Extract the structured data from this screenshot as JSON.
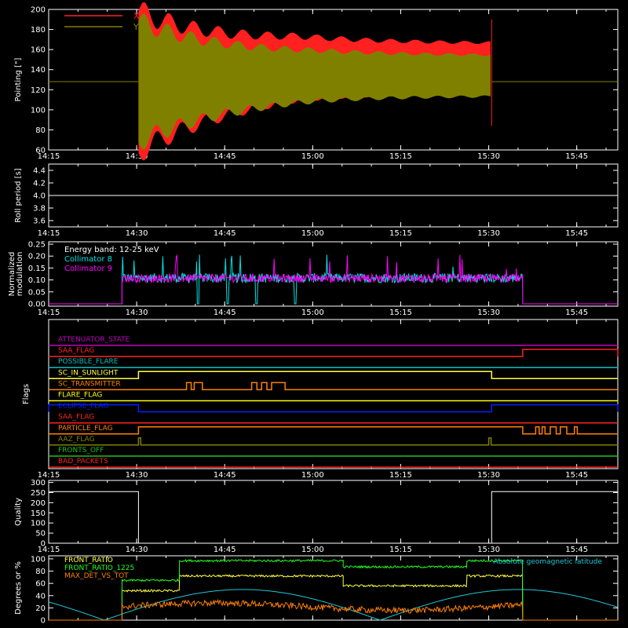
{
  "colors": {
    "background": "#000000",
    "axes": "#ffffff",
    "x_pointing": "#ff2020",
    "y_pointing": "#808000",
    "collimator8": "#00e0e0",
    "collimator9": "#ff00ff",
    "front_ratio": "#ffff40",
    "front_ratio_1225": "#20ff20",
    "max_det": "#ff8000",
    "geomag": "#20c8d8"
  },
  "chart_data": [
    {
      "id": "pointing",
      "type": "area",
      "ylabel": "Pointing [\"]",
      "ylim": [
        60,
        200
      ],
      "yticks": [
        60,
        80,
        100,
        120,
        140,
        160,
        180,
        200
      ],
      "xlim_min": [
        855,
        952
      ],
      "xticks": [
        {
          "m": 855,
          "label": "14:15"
        },
        {
          "m": 870,
          "label": "14:30"
        },
        {
          "m": 885,
          "label": "14:45"
        },
        {
          "m": 900,
          "label": "15:00"
        },
        {
          "m": 915,
          "label": "15:15"
        },
        {
          "m": 930,
          "label": "15:30"
        },
        {
          "m": 945,
          "label": "15:45"
        }
      ],
      "baseline": 128,
      "active_range": [
        870.3,
        930.5
      ],
      "series": [
        {
          "name": "X",
          "color_key": "x_pointing"
        },
        {
          "name": "Y",
          "color_key": "y_pointing"
        }
      ]
    },
    {
      "id": "roll",
      "type": "line",
      "ylabel": "Roll period [s]",
      "ylim": [
        3.5,
        4.5
      ],
      "yticks": [
        3.6,
        3.8,
        4.0,
        4.2,
        4.4
      ],
      "ytick_labels": [
        "3.6",
        "3.8",
        "4.0",
        "4.2",
        "4.4"
      ],
      "xticks_labels": [
        "14:15",
        "14:30",
        "14:45",
        "15:00",
        "15:15",
        "15:30",
        "15:45"
      ],
      "value": 4.0
    },
    {
      "id": "modulation",
      "type": "line",
      "ylabel": "Normalized",
      "ylabel2": "modulation",
      "ylim": [
        -0.01,
        0.26
      ],
      "yticks": [
        0,
        0.05,
        0.1,
        0.15,
        0.2,
        0.25
      ],
      "ytick_labels": [
        "0.00",
        "0.05",
        "0.10",
        "0.15",
        "0.20",
        "0.25"
      ],
      "xticks_labels": [
        "14:15",
        "14:30",
        "14:45",
        "15:00",
        "15:15",
        "15:30",
        "15:45"
      ],
      "annotation": "Energy band: 12-25 keV",
      "active_range": [
        867.5,
        935.8
      ],
      "series": [
        {
          "name": "Collimator 8",
          "color_key": "collimator8",
          "drops": [
            [
              880.3,
              880.7
            ],
            [
              885.3,
              885.7
            ],
            [
              890.2,
              890.6
            ],
            [
              896.8,
              897.2
            ]
          ]
        },
        {
          "name": "Collimator 9",
          "color_key": "collimator9"
        }
      ]
    },
    {
      "id": "flags",
      "type": "line",
      "ylabel": "Flags",
      "xticks_labels": [
        "14:15",
        "14:30",
        "14:45",
        "15:00",
        "15:15",
        "15:30",
        "15:45"
      ],
      "flags": [
        {
          "label": "ATTENUATOR_STATE",
          "color": "#c000c0",
          "steps": []
        },
        {
          "label": "SAA_FLAG",
          "color": "#ff2020",
          "steps": [
            [
              935.8,
              952
            ]
          ]
        },
        {
          "label": "POSSIBLE_FLARE",
          "color": "#00c0c0",
          "steps": []
        },
        {
          "label": "SC_IN_SUNLIGHT",
          "color": "#ffff40",
          "steps": [
            [
              870.3,
              930.5
            ]
          ]
        },
        {
          "label": "SC_TRANSMITTER",
          "color": "#ff8000",
          "steps": [
            [
              878.5,
              879.3
            ],
            [
              879.8,
              881.2
            ],
            [
              889.6,
              890.5
            ],
            [
              891.3,
              892.2
            ],
            [
              893.0,
              895.3
            ]
          ]
        },
        {
          "label": "FLARE_FLAG",
          "color": "#ffff00",
          "steps": []
        },
        {
          "label": "ECLIPSE_FLAG",
          "color": "#0020ff",
          "steps": [
            [
              855,
              870.3
            ],
            [
              930.5,
              952
            ]
          ],
          "base_high": false
        },
        {
          "label": "SAA_FLAG",
          "color": "#ff2020",
          "steps": []
        },
        {
          "label": "PARTICLE_FLAG",
          "color": "#ff8000",
          "steps": [
            [
              870.3,
              935.8
            ],
            [
              938.0,
              938.6
            ],
            [
              939.1,
              939.6
            ],
            [
              940.5,
              941.5
            ],
            [
              942.2,
              943.3
            ],
            [
              944.6,
              945.1
            ]
          ]
        },
        {
          "label": "AAZ_FLAG",
          "color": "#808000",
          "steps": [
            [
              870.3,
              870.7
            ],
            [
              930.0,
              930.4
            ]
          ]
        },
        {
          "label": "FRONTS_OFF",
          "color": "#20c020",
          "steps": []
        },
        {
          "label": "BAD_PACKETS",
          "color": "#ff2020",
          "steps": []
        }
      ]
    },
    {
      "id": "quality",
      "type": "line",
      "ylabel": "Quality",
      "ylim": [
        0,
        310
      ],
      "yticks": [
        0,
        50,
        100,
        150,
        200,
        250,
        300
      ],
      "ytick_labels": [
        "0",
        "50",
        "100",
        "150",
        "200",
        "250",
        "300"
      ],
      "xticks_labels": [
        "14:15",
        "14:30",
        "14:45",
        "15:00",
        "15:15",
        "15:30",
        "15:45"
      ],
      "segments": [
        {
          "x": [
            855,
            870.3
          ],
          "y": 255
        },
        {
          "x": [
            870.3,
            930.5
          ],
          "y": 0
        },
        {
          "x": [
            930.5,
            952
          ],
          "y": 255
        }
      ]
    },
    {
      "id": "ratios",
      "type": "line",
      "ylabel": "Degrees or %",
      "ylim": [
        0,
        105
      ],
      "yticks": [
        0,
        20,
        40,
        60,
        80,
        100
      ],
      "ytick_labels": [
        "0",
        "20",
        "40",
        "60",
        "80",
        "100"
      ],
      "xlim_min": [
        855,
        952
      ],
      "series": [
        {
          "name": "FRONT_RATIO",
          "color_key": "front_ratio",
          "levels": [
            [
              867.5,
              877.3,
              48
            ],
            [
              877.3,
              905.2,
              72
            ],
            [
              905.2,
              926.3,
              56
            ],
            [
              926.3,
              935.8,
              72
            ]
          ]
        },
        {
          "name": "FRONT_RATIO_1225",
          "color_key": "front_ratio_1225",
          "levels": [
            [
              867.5,
              877.3,
              65
            ],
            [
              877.3,
              905.2,
              97
            ],
            [
              905.2,
              926.3,
              87
            ],
            [
              926.3,
              935.8,
              97
            ]
          ]
        },
        {
          "name": "MAX_DET_VS_TOT",
          "color_key": "max_det",
          "levels": [
            [
              867.5,
              935.8,
              22
            ]
          ]
        },
        {
          "name": "Absolute geomagnetic latitude",
          "color_key": "geomag",
          "curve": {
            "amp": 50,
            "period_min": 47,
            "peak_min": 888
          }
        }
      ]
    }
  ]
}
